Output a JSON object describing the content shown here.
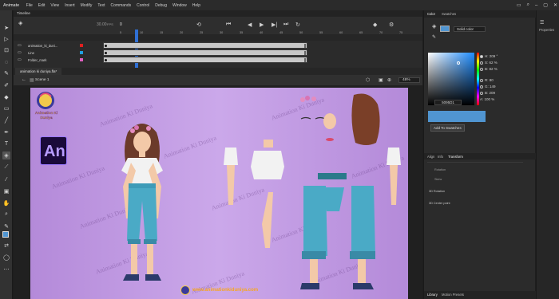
{
  "app": {
    "name": "Animate"
  },
  "menu": [
    "File",
    "Edit",
    "View",
    "Insert",
    "Modify",
    "Text",
    "Commands",
    "Control",
    "Debug",
    "Window",
    "Help"
  ],
  "timeline": {
    "tab": "Timeline",
    "fps": "30.00",
    "fps_unit": "FPS",
    "frame": "0",
    "ruler": [
      "5",
      "10",
      "15",
      "20",
      "25",
      "30",
      "35",
      "40",
      "45",
      "50",
      "55",
      "60",
      "65",
      "70",
      "75"
    ],
    "layers": [
      {
        "name": "animation_ki_duni...",
        "color": "#e02020"
      },
      {
        "name": "Line",
        "color": "#20a0e0"
      },
      {
        "name": "Folder_mark",
        "color": "#e060c0"
      }
    ]
  },
  "document": {
    "tab": "animation ki duniya.fla*",
    "scene": "Scene 1",
    "zoom": "48%"
  },
  "stage": {
    "watermark": "Animation Ki Duniya",
    "app_logo": "An",
    "footer_url": "www.animationkiduniya.com",
    "brand_logo_text": "Animation Ki Duniya"
  },
  "color_panel": {
    "tabs": [
      "Color",
      "Swatches"
    ],
    "fill_type": "Solid color",
    "values": [
      {
        "label": "H:",
        "value": "209 °",
        "selected": true
      },
      {
        "label": "S:",
        "value": "62 %",
        "selected": false
      },
      {
        "label": "B:",
        "value": "82 %",
        "selected": false
      },
      {
        "label": "R:",
        "value": "80",
        "selected": false
      },
      {
        "label": "G:",
        "value": "149",
        "selected": false
      },
      {
        "label": "B:",
        "value": "209",
        "selected": false
      }
    ],
    "alpha_label": "A:",
    "alpha": "100 %",
    "hex": "5095D1",
    "swatch_color": "#5095d1",
    "add_swatch": "Add To Swatches"
  },
  "transform_panel": {
    "tabs": [
      "Align",
      "Info",
      "Transform"
    ],
    "rotation_label": "Rotation",
    "skew_label": "Skew",
    "rot3d_label": "3D Rotation",
    "center3d_label": "3D Center point"
  },
  "library_panel": {
    "tabs": [
      "Library",
      "Motion Presets"
    ]
  },
  "right_strip": {
    "label": "Properties"
  },
  "colors": {
    "accent": "#3a8fe0",
    "stage_bg": "#c3a0e6"
  }
}
